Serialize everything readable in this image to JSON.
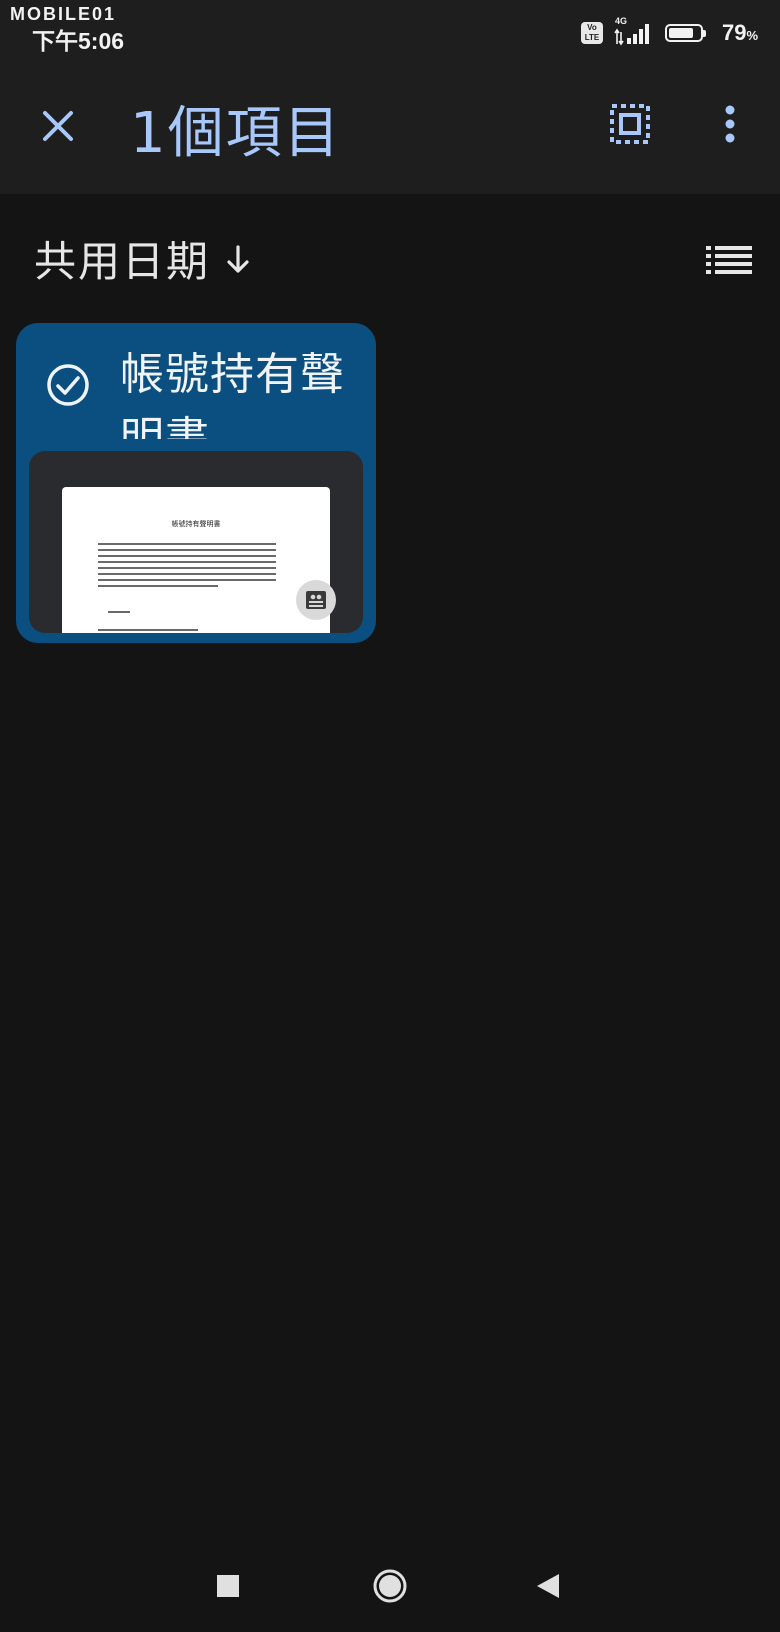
{
  "status_bar": {
    "watermark": "MOBILE01",
    "time": "下午5:06",
    "volte_top": "Vo",
    "volte_bottom": "LTE",
    "network": "4G",
    "battery_percent": "79",
    "battery_unit": "%",
    "battery_level": 0.79
  },
  "app_bar": {
    "title": "1個項目",
    "close_icon": "close-icon",
    "select_all_icon": "select-all-icon",
    "more_icon": "more-vert-icon",
    "accent_color": "#a8c7fa"
  },
  "sort": {
    "label": "共用日期",
    "direction_icon": "arrow-down-icon",
    "view_icon": "list-view-icon"
  },
  "file": {
    "name": "帳號持有聲明書",
    "selected": true,
    "card_color": "#0b4f80",
    "thumbnail": {
      "heading": "帳號持有聲明書"
    },
    "badge_icon": "shared-drive-icon"
  },
  "nav_bar": {
    "recents_icon": "recents-icon",
    "home_icon": "home-icon",
    "back_icon": "back-icon"
  }
}
